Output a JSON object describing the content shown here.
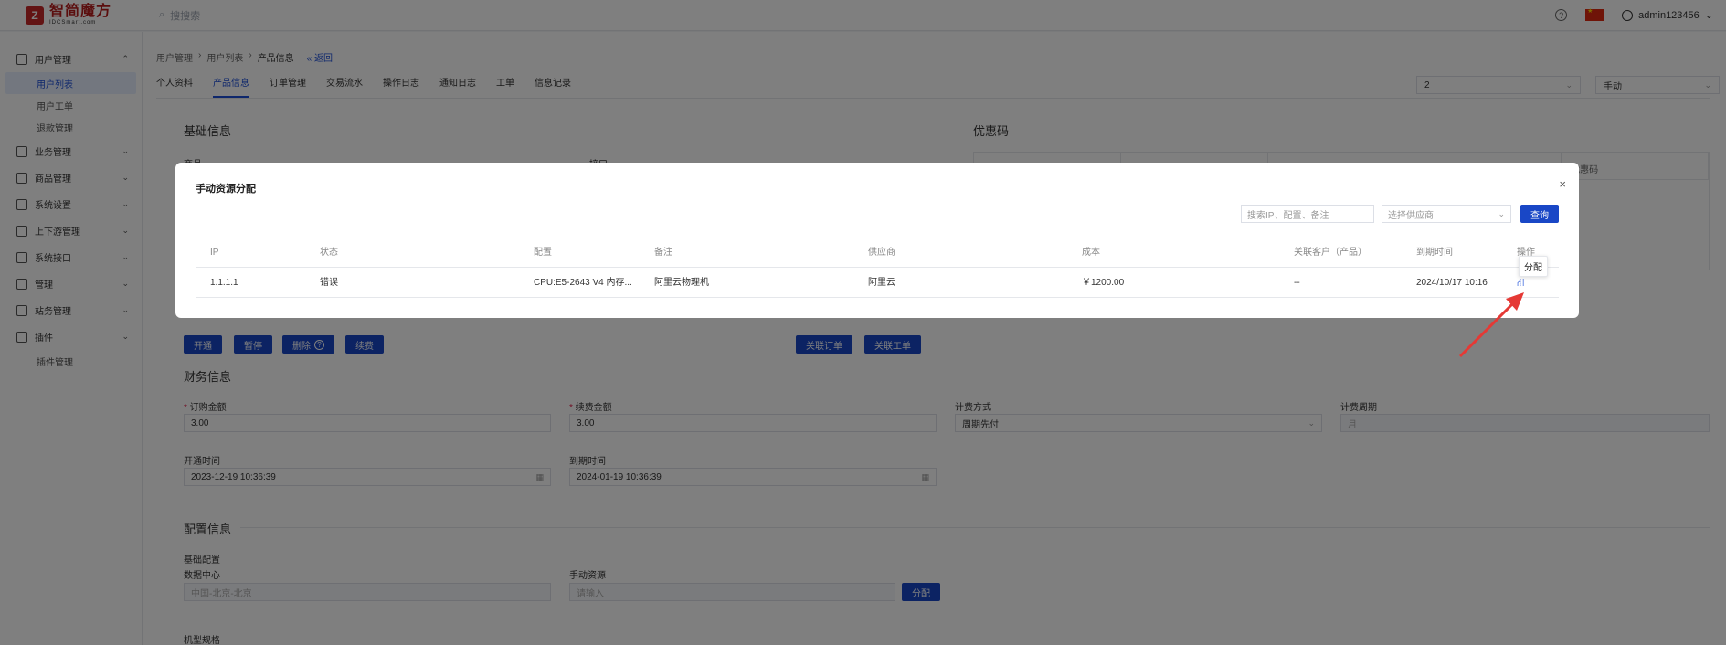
{
  "header": {
    "logo_main": "智简魔方",
    "logo_sub": "IDCSmart.com",
    "search_placeholder": "搜搜索",
    "help_icon": "question-circle-icon",
    "username": "admin123456"
  },
  "sidebar": {
    "groups": [
      {
        "label": "用户管理",
        "icon": "user-icon",
        "expanded": true,
        "children": [
          "用户列表",
          "用户工单",
          "退款管理"
        ]
      },
      {
        "label": "业务管理",
        "icon": "list-icon"
      },
      {
        "label": "商品管理",
        "icon": "cart-icon"
      },
      {
        "label": "系统设置",
        "icon": "gear-icon"
      },
      {
        "label": "上下游管理",
        "icon": "filter-icon"
      },
      {
        "label": "系统接口",
        "icon": "interface-icon"
      },
      {
        "label": "管理",
        "icon": "grid-icon"
      },
      {
        "label": "站务管理",
        "icon": "flag-icon"
      },
      {
        "label": "插件",
        "icon": "cube-icon",
        "children": [
          "插件管理"
        ]
      }
    ]
  },
  "breadcrumb": {
    "items": [
      "用户管理",
      "用户列表",
      "产品信息"
    ],
    "back": "« 返回"
  },
  "tabs": [
    "个人资料",
    "产品信息",
    "订单管理",
    "交易流水",
    "操作日志",
    "通知日志",
    "工单",
    "信息记录"
  ],
  "top_selects": {
    "product": "2",
    "mode": "手动"
  },
  "sections": {
    "basic": "基础信息",
    "basic_product_label": "商品",
    "basic_interface_label": "接口",
    "promo": "优惠码",
    "promo_head_last": "优惠码",
    "finance": "财务信息",
    "config": "配置信息"
  },
  "action_buttons": {
    "open": "开通",
    "pause": "暂停",
    "delete": "删除",
    "renew": "续费",
    "related_order": "关联订单",
    "related_ticket": "关联工单"
  },
  "finance": {
    "order_amount_label": "订购金额",
    "order_amount": "3.00",
    "renew_amount_label": "续费金额",
    "renew_amount": "3.00",
    "billing_label": "计费方式",
    "billing_value": "周期先付",
    "cycle_label": "计费周期",
    "cycle_value": "月",
    "open_time_label": "开通时间",
    "open_time": "2023-12-19 10:36:39",
    "expire_label": "到期时间",
    "expire_time": "2024-01-19 10:36:39"
  },
  "config": {
    "base_label": "基础配置",
    "dc_label": "数据中心",
    "dc_value": "中国-北京-北京",
    "manual_label": "手动资源",
    "manual_placeholder": "请输入",
    "assign_btn": "分配",
    "model_label": "机型规格"
  },
  "modal": {
    "title": "手动资源分配",
    "close": "×",
    "search_placeholder": "搜索IP、配置、备注",
    "supplier_placeholder": "选择供应商",
    "query_btn": "查询",
    "columns": [
      "IP",
      "状态",
      "配置",
      "备注",
      "供应商",
      "成本",
      "关联客户（产品）",
      "到期时间",
      "操作"
    ],
    "rows": [
      {
        "ip": "1.1.1.1",
        "status": "错误",
        "config": "CPU:E5-2643 V4 内存...",
        "note": "阿里云物理机",
        "supplier": "阿里云",
        "cost": "￥1200.00",
        "customer": "--",
        "expire": "2024/10/17 10:16"
      }
    ],
    "tooltip": "分配"
  },
  "colors": {
    "primary": "#1947c6",
    "arrow": "#e53935",
    "brand": "#b71c1c"
  }
}
